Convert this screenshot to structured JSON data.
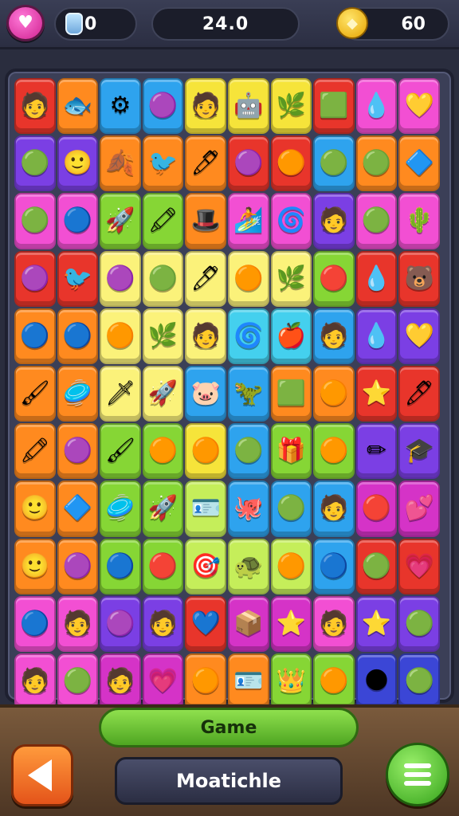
{
  "top_bar": {
    "heart_icon": "heart-icon",
    "left_counter": {
      "icon": "potion-bottle-icon",
      "value": "0"
    },
    "score": "24.0",
    "coins": {
      "icon": "gold-coin-icon",
      "value": "60"
    }
  },
  "board": {
    "rows": [
      [
        {
          "c": "#e8352b",
          "g": "🧑"
        },
        {
          "c": "#ff8a1f",
          "g": "🐟"
        },
        {
          "c": "#2ea3ee",
          "g": "⚙"
        },
        {
          "c": "#2ea3ee",
          "g": "🟣"
        },
        {
          "c": "#f6e43a",
          "g": "🧑"
        },
        {
          "c": "#f6e43a",
          "g": "🤖"
        },
        {
          "c": "#f6e43a",
          "g": "🌿"
        },
        {
          "c": "#e8352b",
          "g": "🟩"
        },
        {
          "c": "#f24fd3",
          "g": "💧"
        },
        {
          "c": "#f24fd3",
          "g": "💛"
        }
      ],
      [
        {
          "c": "#7b3fe4",
          "g": "🟢"
        },
        {
          "c": "#7b3fe4",
          "g": "🙂"
        },
        {
          "c": "#ff8a1f",
          "g": "🍂"
        },
        {
          "c": "#ff8a1f",
          "g": "🐦"
        },
        {
          "c": "#ff8a1f",
          "g": "🖊"
        },
        {
          "c": "#e8352b",
          "g": "🟣"
        },
        {
          "c": "#e8352b",
          "g": "🟠"
        },
        {
          "c": "#2ea3ee",
          "g": "🟢"
        },
        {
          "c": "#ff8a1f",
          "g": "🟢"
        },
        {
          "c": "#ff8a1f",
          "g": "🔷"
        }
      ],
      [
        {
          "c": "#f24fd3",
          "g": "🟢"
        },
        {
          "c": "#f24fd3",
          "g": "🔵"
        },
        {
          "c": "#86d635",
          "g": "🚀"
        },
        {
          "c": "#86d635",
          "g": "🖍"
        },
        {
          "c": "#ff8a1f",
          "g": "🎩"
        },
        {
          "c": "#f24fd3",
          "g": "🏄"
        },
        {
          "c": "#f24fd3",
          "g": "🌀"
        },
        {
          "c": "#7b3fe4",
          "g": "🧑"
        },
        {
          "c": "#f24fd3",
          "g": "🟢"
        },
        {
          "c": "#f24fd3",
          "g": "🌵"
        }
      ],
      [
        {
          "c": "#e8352b",
          "g": "🟣"
        },
        {
          "c": "#e8352b",
          "g": "🐦"
        },
        {
          "c": "#fbf27a",
          "g": "🟣"
        },
        {
          "c": "#fbf27a",
          "g": "🟢"
        },
        {
          "c": "#fbf27a",
          "g": "🖊"
        },
        {
          "c": "#fbf27a",
          "g": "🟠"
        },
        {
          "c": "#fbf27a",
          "g": "🌿"
        },
        {
          "c": "#86d635",
          "g": "🔴"
        },
        {
          "c": "#e8352b",
          "g": "💧"
        },
        {
          "c": "#e8352b",
          "g": "🐻"
        }
      ],
      [
        {
          "c": "#ff8a1f",
          "g": "🔵"
        },
        {
          "c": "#ff8a1f",
          "g": "🔵"
        },
        {
          "c": "#fbf27a",
          "g": "🟠"
        },
        {
          "c": "#fbf27a",
          "g": "🌿"
        },
        {
          "c": "#fbf27a",
          "g": "🧑"
        },
        {
          "c": "#44d0ee",
          "g": "🌀"
        },
        {
          "c": "#44d0ee",
          "g": "🍎"
        },
        {
          "c": "#2ea3ee",
          "g": "🧑"
        },
        {
          "c": "#7b3fe4",
          "g": "💧"
        },
        {
          "c": "#7b3fe4",
          "g": "💛"
        }
      ],
      [
        {
          "c": "#ff8a1f",
          "g": "🖌"
        },
        {
          "c": "#ff8a1f",
          "g": "🥏"
        },
        {
          "c": "#fbf27a",
          "g": "🗡"
        },
        {
          "c": "#fbf27a",
          "g": "🚀"
        },
        {
          "c": "#2ea3ee",
          "g": "🐷"
        },
        {
          "c": "#2ea3ee",
          "g": "🦖"
        },
        {
          "c": "#ff8a1f",
          "g": "🟩"
        },
        {
          "c": "#ff8a1f",
          "g": "🟠"
        },
        {
          "c": "#e8352b",
          "g": "⭐"
        },
        {
          "c": "#e8352b",
          "g": "🖊"
        }
      ],
      [
        {
          "c": "#ff8a1f",
          "g": "🖍"
        },
        {
          "c": "#ff8a1f",
          "g": "🟣"
        },
        {
          "c": "#86d635",
          "g": "🖌"
        },
        {
          "c": "#86d635",
          "g": "🟠"
        },
        {
          "c": "#f6e43a",
          "g": "🟠"
        },
        {
          "c": "#2ea3ee",
          "g": "🟢"
        },
        {
          "c": "#86d635",
          "g": "🎁"
        },
        {
          "c": "#86d635",
          "g": "🟠"
        },
        {
          "c": "#7b3fe4",
          "g": "✏"
        },
        {
          "c": "#7b3fe4",
          "g": "🎓"
        }
      ],
      [
        {
          "c": "#ff8a1f",
          "g": "🙂"
        },
        {
          "c": "#ff8a1f",
          "g": "🔷"
        },
        {
          "c": "#86d635",
          "g": "🥏"
        },
        {
          "c": "#86d635",
          "g": "🚀"
        },
        {
          "c": "#c5ee5a",
          "g": "🪪"
        },
        {
          "c": "#2ea3ee",
          "g": "🐙"
        },
        {
          "c": "#2ea3ee",
          "g": "🟢"
        },
        {
          "c": "#2ea3ee",
          "g": "🧑"
        },
        {
          "c": "#d533c7",
          "g": "🔴"
        },
        {
          "c": "#d533c7",
          "g": "💕"
        }
      ],
      [
        {
          "c": "#ff8a1f",
          "g": "🙂"
        },
        {
          "c": "#ff8a1f",
          "g": "🟣"
        },
        {
          "c": "#86d635",
          "g": "🔵"
        },
        {
          "c": "#86d635",
          "g": "🔴"
        },
        {
          "c": "#c5ee5a",
          "g": "🎯"
        },
        {
          "c": "#c5ee5a",
          "g": "🐢"
        },
        {
          "c": "#c5ee5a",
          "g": "🟠"
        },
        {
          "c": "#2ea3ee",
          "g": "🔵"
        },
        {
          "c": "#e8352b",
          "g": "🟢"
        },
        {
          "c": "#e8352b",
          "g": "💗"
        }
      ],
      [
        {
          "c": "#f24fd3",
          "g": "🔵"
        },
        {
          "c": "#f24fd3",
          "g": "🧑"
        },
        {
          "c": "#7b3fe4",
          "g": "🟣"
        },
        {
          "c": "#7b3fe4",
          "g": "🧑"
        },
        {
          "c": "#e8352b",
          "g": "💙"
        },
        {
          "c": "#d533c7",
          "g": "📦"
        },
        {
          "c": "#d533c7",
          "g": "⭐"
        },
        {
          "c": "#f24fd3",
          "g": "🧑"
        },
        {
          "c": "#7b3fe4",
          "g": "⭐"
        },
        {
          "c": "#7b3fe4",
          "g": "🟢"
        }
      ],
      [
        {
          "c": "#f24fd3",
          "g": "🧑"
        },
        {
          "c": "#f24fd3",
          "g": "🟢"
        },
        {
          "c": "#d533c7",
          "g": "🧑"
        },
        {
          "c": "#d533c7",
          "g": "💗"
        },
        {
          "c": "#ff8a1f",
          "g": "🟠"
        },
        {
          "c": "#ff8a1f",
          "g": "🪪"
        },
        {
          "c": "#86d635",
          "g": "👑"
        },
        {
          "c": "#86d635",
          "g": "🟠"
        },
        {
          "c": "#3b46d6",
          "g": "🌑"
        },
        {
          "c": "#3b46d6",
          "g": "🟢"
        }
      ]
    ]
  },
  "bottom_bar": {
    "game_button_label": "Game",
    "match_button_label": "Moatichle",
    "back_icon": "back-arrow-icon",
    "menu_icon": "menu-icon"
  }
}
